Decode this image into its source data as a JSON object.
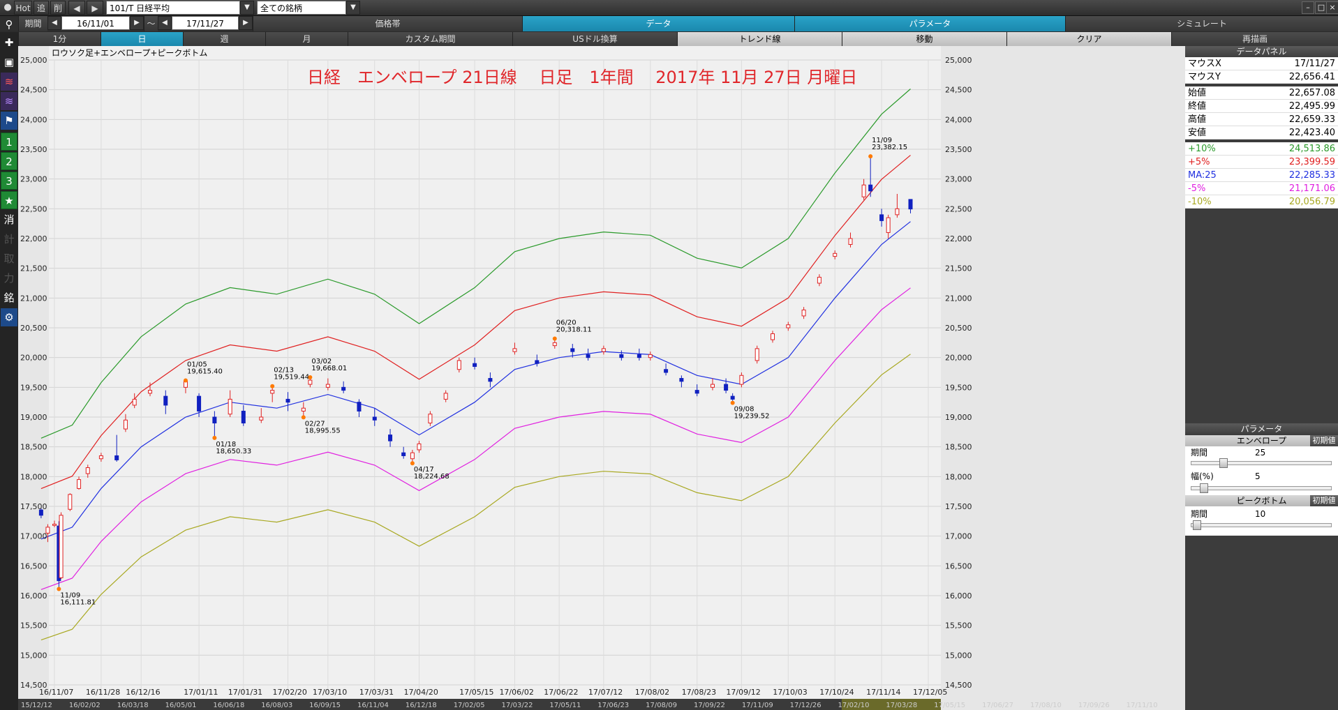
{
  "topbar": {
    "hot": "Hot",
    "add": "追",
    "del": "削",
    "symbol": "101/T 日経平均",
    "filter": "全ての銘柄",
    "period_label": "期間",
    "date_from": "16/11/01",
    "tilde": "～",
    "date_to": "17/11/27"
  },
  "menu": {
    "price_band": "価格帯",
    "data": "データ",
    "parameter": "パラメータ",
    "simulate": "シミュレート"
  },
  "timeframes": {
    "m1": "1分",
    "day": "日",
    "week": "週",
    "month": "月",
    "custom": "カスタム期間",
    "usd": "USドル換算",
    "trend": "トレンド線",
    "move": "移動",
    "clear": "クリア",
    "redraw": "再描画"
  },
  "left_toolbar": {
    "n1": "1",
    "n2": "2",
    "n3": "3",
    "k_erase": "消",
    "k_calc": "計",
    "k_take": "取",
    "k_power": "力",
    "k_brand": "銘"
  },
  "chart_data": {
    "type": "candlestick",
    "corner_label": "ロウソク足+エンベロープ+ピークボトム",
    "title": "日経　エンベロープ 21日線　 日足　1年間　 2017年 11月 27日 月曜日",
    "ylim": [
      14500,
      25000
    ],
    "yticks": [
      "14,500",
      "15,000",
      "15,500",
      "16,000",
      "16,500",
      "17,000",
      "17,500",
      "18,000",
      "18,500",
      "19,000",
      "19,500",
      "20,000",
      "20,500",
      "21,000",
      "21,500",
      "22,000",
      "22,500",
      "23,000",
      "23,500",
      "24,000",
      "24,500",
      "25,000"
    ],
    "xticks": [
      "16/11/07",
      "16/11/28",
      "16/12/16",
      "17/01/11",
      "17/01/31",
      "17/02/20",
      "17/03/10",
      "17/03/31",
      "17/04/20",
      "17/05/15",
      "17/06/02",
      "17/06/22",
      "17/07/12",
      "17/08/02",
      "17/08/23",
      "17/09/12",
      "17/10/03",
      "17/10/24",
      "17/11/14",
      "17/12/05"
    ],
    "bottom_scroll_dates": [
      "15/12/12",
      "16/02/02",
      "16/03/18",
      "16/05/01",
      "16/06/18",
      "16/08/03",
      "16/09/15",
      "16/11/04",
      "16/12/18",
      "17/02/05",
      "17/03/22",
      "17/05/11",
      "17/06/23",
      "17/08/09",
      "17/09/22",
      "17/11/09",
      "17/12/26",
      "17/02/10",
      "17/03/28",
      "17/05/15",
      "17/06/27",
      "17/08/10",
      "17/09/26",
      "17/11/10"
    ],
    "series_colors": {
      "ma": "#2030e0",
      "p5": "#e02020",
      "p10": "#2a9a2a",
      "m5": "#e020e0",
      "m10": "#a8a820"
    },
    "ma_points": [
      {
        "d": "16/11/01",
        "v": 16950
      },
      {
        "d": "16/11/15",
        "v": 17150
      },
      {
        "d": "16/11/28",
        "v": 17800
      },
      {
        "d": "16/12/16",
        "v": 18500
      },
      {
        "d": "17/01/05",
        "v": 19000
      },
      {
        "d": "17/01/25",
        "v": 19250
      },
      {
        "d": "17/02/15",
        "v": 19150
      },
      {
        "d": "17/03/10",
        "v": 19380
      },
      {
        "d": "17/03/31",
        "v": 19150
      },
      {
        "d": "17/04/20",
        "v": 18700
      },
      {
        "d": "17/05/15",
        "v": 19250
      },
      {
        "d": "17/06/02",
        "v": 19800
      },
      {
        "d": "17/06/22",
        "v": 20000
      },
      {
        "d": "17/07/12",
        "v": 20100
      },
      {
        "d": "17/08/02",
        "v": 20050
      },
      {
        "d": "17/08/23",
        "v": 19700
      },
      {
        "d": "17/09/12",
        "v": 19550
      },
      {
        "d": "17/10/03",
        "v": 20000
      },
      {
        "d": "17/10/24",
        "v": 21000
      },
      {
        "d": "17/11/14",
        "v": 21900
      },
      {
        "d": "17/11/27",
        "v": 22285
      }
    ],
    "candles": [
      {
        "d": "16/11/01",
        "o": 17440,
        "c": 17350,
        "h": 17470,
        "l": 17300
      },
      {
        "d": "16/11/04",
        "o": 17050,
        "c": 17150,
        "h": 17200,
        "l": 16900
      },
      {
        "d": "16/11/07",
        "o": 17180,
        "c": 17200,
        "h": 17260,
        "l": 17150
      },
      {
        "d": "16/11/09",
        "o": 17170,
        "c": 16250,
        "h": 17250,
        "l": 16111
      },
      {
        "d": "16/11/10",
        "o": 16300,
        "c": 17350,
        "h": 17400,
        "l": 16280
      },
      {
        "d": "16/11/14",
        "o": 17450,
        "c": 17700,
        "h": 17720,
        "l": 17420
      },
      {
        "d": "16/11/18",
        "o": 17800,
        "c": 17950,
        "h": 18000,
        "l": 17780
      },
      {
        "d": "16/11/22",
        "o": 18050,
        "c": 18150,
        "h": 18200,
        "l": 17980
      },
      {
        "d": "16/11/28",
        "o": 18300,
        "c": 18350,
        "h": 18400,
        "l": 18250
      },
      {
        "d": "16/12/05",
        "o": 18350,
        "c": 18280,
        "h": 18700,
        "l": 18250
      },
      {
        "d": "16/12/09",
        "o": 18800,
        "c": 18950,
        "h": 19050,
        "l": 18750
      },
      {
        "d": "16/12/13",
        "o": 19200,
        "c": 19300,
        "h": 19400,
        "l": 19150
      },
      {
        "d": "16/12/20",
        "o": 19400,
        "c": 19450,
        "h": 19580,
        "l": 19350
      },
      {
        "d": "16/12/27",
        "o": 19350,
        "c": 19200,
        "h": 19450,
        "l": 19050
      },
      {
        "d": "17/01/05",
        "o": 19500,
        "c": 19600,
        "h": 19615,
        "l": 19400
      },
      {
        "d": "17/01/11",
        "o": 19350,
        "c": 19100,
        "h": 19400,
        "l": 19000
      },
      {
        "d": "17/01/18",
        "o": 19000,
        "c": 18900,
        "h": 19100,
        "l": 18650
      },
      {
        "d": "17/01/25",
        "o": 19050,
        "c": 19300,
        "h": 19450,
        "l": 19000
      },
      {
        "d": "17/01/31",
        "o": 19100,
        "c": 18900,
        "h": 19200,
        "l": 18850
      },
      {
        "d": "17/02/08",
        "o": 18950,
        "c": 19000,
        "h": 19150,
        "l": 18900
      },
      {
        "d": "17/02/13",
        "o": 19400,
        "c": 19450,
        "h": 19519,
        "l": 19250
      },
      {
        "d": "17/02/20",
        "o": 19300,
        "c": 19250,
        "h": 19420,
        "l": 19100
      },
      {
        "d": "17/02/27",
        "o": 19100,
        "c": 19150,
        "h": 19250,
        "l": 18995
      },
      {
        "d": "17/03/02",
        "o": 19550,
        "c": 19620,
        "h": 19668,
        "l": 19500
      },
      {
        "d": "17/03/10",
        "o": 19500,
        "c": 19550,
        "h": 19650,
        "l": 19450
      },
      {
        "d": "17/03/17",
        "o": 19500,
        "c": 19450,
        "h": 19600,
        "l": 19400
      },
      {
        "d": "17/03/24",
        "o": 19250,
        "c": 19100,
        "h": 19300,
        "l": 19000
      },
      {
        "d": "17/03/31",
        "o": 19000,
        "c": 18950,
        "h": 19150,
        "l": 18850
      },
      {
        "d": "17/04/07",
        "o": 18700,
        "c": 18600,
        "h": 18800,
        "l": 18500
      },
      {
        "d": "17/04/13",
        "o": 18400,
        "c": 18350,
        "h": 18500,
        "l": 18300
      },
      {
        "d": "17/04/17",
        "o": 18300,
        "c": 18400,
        "h": 18450,
        "l": 18224
      },
      {
        "d": "17/04/20",
        "o": 18450,
        "c": 18550,
        "h": 18600,
        "l": 18400
      },
      {
        "d": "17/04/25",
        "o": 18900,
        "c": 19050,
        "h": 19100,
        "l": 18850
      },
      {
        "d": "17/05/02",
        "o": 19300,
        "c": 19400,
        "h": 19450,
        "l": 19250
      },
      {
        "d": "17/05/08",
        "o": 19800,
        "c": 19950,
        "h": 20000,
        "l": 19750
      },
      {
        "d": "17/05/15",
        "o": 19900,
        "c": 19850,
        "h": 20000,
        "l": 19800
      },
      {
        "d": "17/05/22",
        "o": 19650,
        "c": 19600,
        "h": 19750,
        "l": 19500
      },
      {
        "d": "17/06/02",
        "o": 20100,
        "c": 20150,
        "h": 20250,
        "l": 20050
      },
      {
        "d": "17/06/12",
        "o": 19950,
        "c": 19900,
        "h": 20050,
        "l": 19850
      },
      {
        "d": "17/06/20",
        "o": 20200,
        "c": 20250,
        "h": 20318,
        "l": 20150
      },
      {
        "d": "17/06/28",
        "o": 20150,
        "c": 20100,
        "h": 20230,
        "l": 20000
      },
      {
        "d": "17/07/05",
        "o": 20050,
        "c": 20000,
        "h": 20150,
        "l": 19950
      },
      {
        "d": "17/07/12",
        "o": 20100,
        "c": 20150,
        "h": 20200,
        "l": 20050
      },
      {
        "d": "17/07/20",
        "o": 20050,
        "c": 20000,
        "h": 20120,
        "l": 19950
      },
      {
        "d": "17/07/28",
        "o": 20050,
        "c": 20000,
        "h": 20150,
        "l": 19950
      },
      {
        "d": "17/08/02",
        "o": 20000,
        "c": 20050,
        "h": 20100,
        "l": 19950
      },
      {
        "d": "17/08/09",
        "o": 19800,
        "c": 19750,
        "h": 19900,
        "l": 19700
      },
      {
        "d": "17/08/16",
        "o": 19650,
        "c": 19600,
        "h": 19700,
        "l": 19500
      },
      {
        "d": "17/08/23",
        "o": 19450,
        "c": 19400,
        "h": 19550,
        "l": 19350
      },
      {
        "d": "17/08/30",
        "o": 19500,
        "c": 19550,
        "h": 19650,
        "l": 19450
      },
      {
        "d": "17/09/05",
        "o": 19550,
        "c": 19450,
        "h": 19650,
        "l": 19400
      },
      {
        "d": "17/09/08",
        "o": 19350,
        "c": 19300,
        "h": 19400,
        "l": 19239
      },
      {
        "d": "17/09/12",
        "o": 19550,
        "c": 19700,
        "h": 19750,
        "l": 19500
      },
      {
        "d": "17/09/19",
        "o": 19950,
        "c": 20150,
        "h": 20200,
        "l": 19900
      },
      {
        "d": "17/09/26",
        "o": 20300,
        "c": 20400,
        "h": 20450,
        "l": 20250
      },
      {
        "d": "17/10/03",
        "o": 20500,
        "c": 20550,
        "h": 20600,
        "l": 20450
      },
      {
        "d": "17/10/10",
        "o": 20700,
        "c": 20800,
        "h": 20850,
        "l": 20650
      },
      {
        "d": "17/10/17",
        "o": 21250,
        "c": 21350,
        "h": 21400,
        "l": 21200
      },
      {
        "d": "17/10/24",
        "o": 21700,
        "c": 21750,
        "h": 21800,
        "l": 21650
      },
      {
        "d": "17/10/31",
        "o": 21900,
        "c": 22000,
        "h": 22100,
        "l": 21850
      },
      {
        "d": "17/11/06",
        "o": 22700,
        "c": 22900,
        "h": 23000,
        "l": 22650
      },
      {
        "d": "17/11/09",
        "o": 22900,
        "c": 22800,
        "h": 23382,
        "l": 22700
      },
      {
        "d": "17/11/14",
        "o": 22400,
        "c": 22300,
        "h": 22500,
        "l": 22200
      },
      {
        "d": "17/11/17",
        "o": 22100,
        "c": 22350,
        "h": 22400,
        "l": 22000
      },
      {
        "d": "17/11/21",
        "o": 22400,
        "c": 22500,
        "h": 22750,
        "l": 22350
      },
      {
        "d": "17/11/27",
        "o": 22657,
        "c": 22496,
        "h": 22659,
        "l": 22423
      }
    ],
    "peaks": [
      {
        "d": "16/11/09",
        "v": 16111,
        "date": "11/09",
        "value": "16,111.81",
        "pos": "below"
      },
      {
        "d": "17/01/05",
        "v": 19615,
        "date": "01/05",
        "value": "19,615.40",
        "pos": "above"
      },
      {
        "d": "17/01/18",
        "v": 18650,
        "date": "01/18",
        "value": "18,650.33",
        "pos": "below"
      },
      {
        "d": "17/02/13",
        "v": 19519,
        "date": "02/13",
        "value": "19,519.44",
        "pos": "above"
      },
      {
        "d": "17/02/27",
        "v": 18995,
        "date": "02/27",
        "value": "18,995.55",
        "pos": "below"
      },
      {
        "d": "17/03/02",
        "v": 19668,
        "date": "03/02",
        "value": "19,668.01",
        "pos": "above"
      },
      {
        "d": "17/04/17",
        "v": 18224,
        "date": "04/17",
        "value": "18,224.68",
        "pos": "below"
      },
      {
        "d": "17/06/20",
        "v": 20318,
        "date": "06/20",
        "value": "20,318.11",
        "pos": "above"
      },
      {
        "d": "17/09/08",
        "v": 19239,
        "date": "09/08",
        "value": "19,239.52",
        "pos": "below"
      },
      {
        "d": "17/11/09",
        "v": 23382,
        "date": "11/09",
        "value": "23,382.15",
        "pos": "above"
      }
    ]
  },
  "data_panel": {
    "title": "データパネル",
    "rows": [
      {
        "k": "マウスX",
        "v": "17/11/27",
        "color": "#000000"
      },
      {
        "k": "マウスY",
        "v": "22,656.41",
        "color": "#000000"
      },
      {
        "k": "始値",
        "v": "22,657.08",
        "color": "#000000"
      },
      {
        "k": "終値",
        "v": "22,495.99",
        "color": "#000000"
      },
      {
        "k": "高値",
        "v": "22,659.33",
        "color": "#000000"
      },
      {
        "k": "安値",
        "v": "22,423.40",
        "color": "#000000"
      },
      {
        "k": "+10%",
        "v": "24,513.86",
        "color": "#2a9a2a"
      },
      {
        "k": "+5%",
        "v": "23,399.59",
        "color": "#e02020"
      },
      {
        "k": "MA:25",
        "v": "22,285.33",
        "color": "#2030e0"
      },
      {
        "k": "-5%",
        "v": "21,171.06",
        "color": "#e020e0"
      },
      {
        "k": "-10%",
        "v": "20,056.79",
        "color": "#a8a820"
      }
    ]
  },
  "param_panel": {
    "title": "パラメータ",
    "envelope": "エンベロープ",
    "reset": "初期値",
    "period_label": "期間",
    "period_value": "25",
    "width_label": "幅(%)",
    "width_value": "5",
    "peak": "ピークボトム",
    "reset2": "初期値",
    "pb_period_label": "期間",
    "pb_period_value": "10"
  }
}
